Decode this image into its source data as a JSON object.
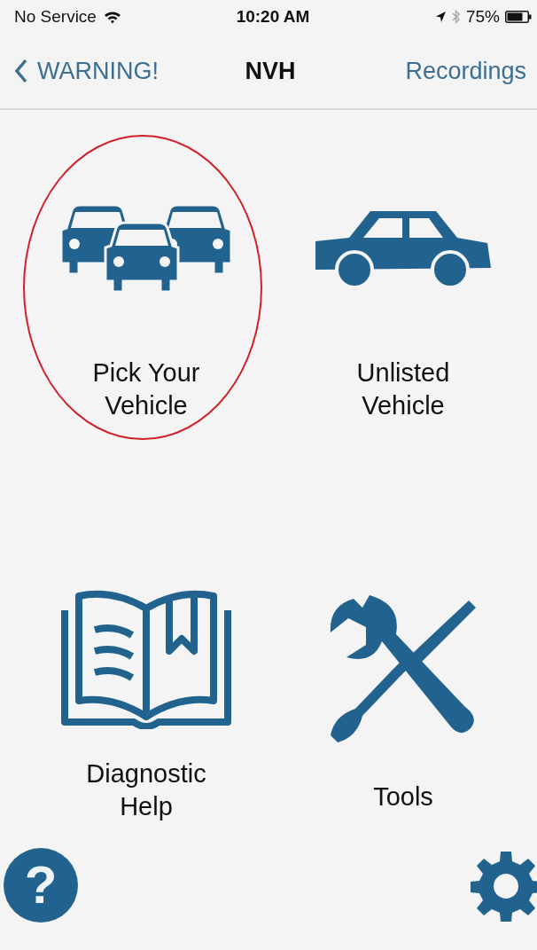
{
  "status_bar": {
    "carrier": "No Service",
    "time": "10:20 AM",
    "battery": "75%"
  },
  "nav": {
    "back": "WARNING!",
    "title": "NVH",
    "action": "Recordings"
  },
  "tiles": [
    {
      "kind": "cars",
      "label": "Pick Your Vehicle",
      "circled": true
    },
    {
      "kind": "car",
      "label": "Unlisted Vehicle",
      "circled": false
    },
    {
      "kind": "book",
      "label": "Diagnostic Help",
      "circled": false
    },
    {
      "kind": "tools",
      "label": "Tools",
      "circled": false
    }
  ],
  "help_button": {
    "label": "?"
  }
}
